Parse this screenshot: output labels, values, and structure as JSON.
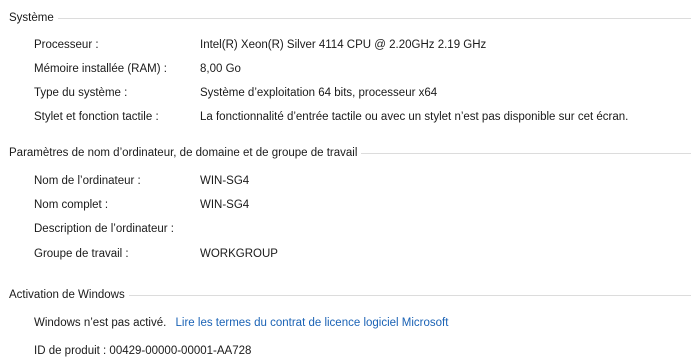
{
  "system": {
    "title": "Système",
    "rows": [
      {
        "label": "Processeur :",
        "value": "Intel(R) Xeon(R) Silver 4114 CPU @ 2.20GHz   2.19 GHz"
      },
      {
        "label": "Mémoire installée (RAM) :",
        "value": "8,00 Go"
      },
      {
        "label": "Type du système :",
        "value": "Système d’exploitation 64 bits, processeur x64"
      },
      {
        "label": "Stylet et fonction tactile :",
        "value": "La fonctionnalité d’entrée tactile ou avec un stylet n’est pas disponible sur cet écran."
      }
    ]
  },
  "computer": {
    "title": "Paramètres de nom d’ordinateur, de domaine et de groupe de travail",
    "rows": [
      {
        "label": "Nom de l’ordinateur :",
        "value": "WIN-SG4"
      },
      {
        "label": "Nom complet :",
        "value": "WIN-SG4"
      },
      {
        "label": "Description de l’ordinateur :",
        "value": ""
      },
      {
        "label": "Groupe de travail :",
        "value": "WORKGROUP"
      }
    ]
  },
  "activation": {
    "title": "Activation de Windows",
    "status": "Windows n’est pas activé.",
    "license_link": "Lire les termes du contrat de licence logiciel Microsoft",
    "product_id": "ID de produit : 00429-00000-00001-AA728"
  }
}
